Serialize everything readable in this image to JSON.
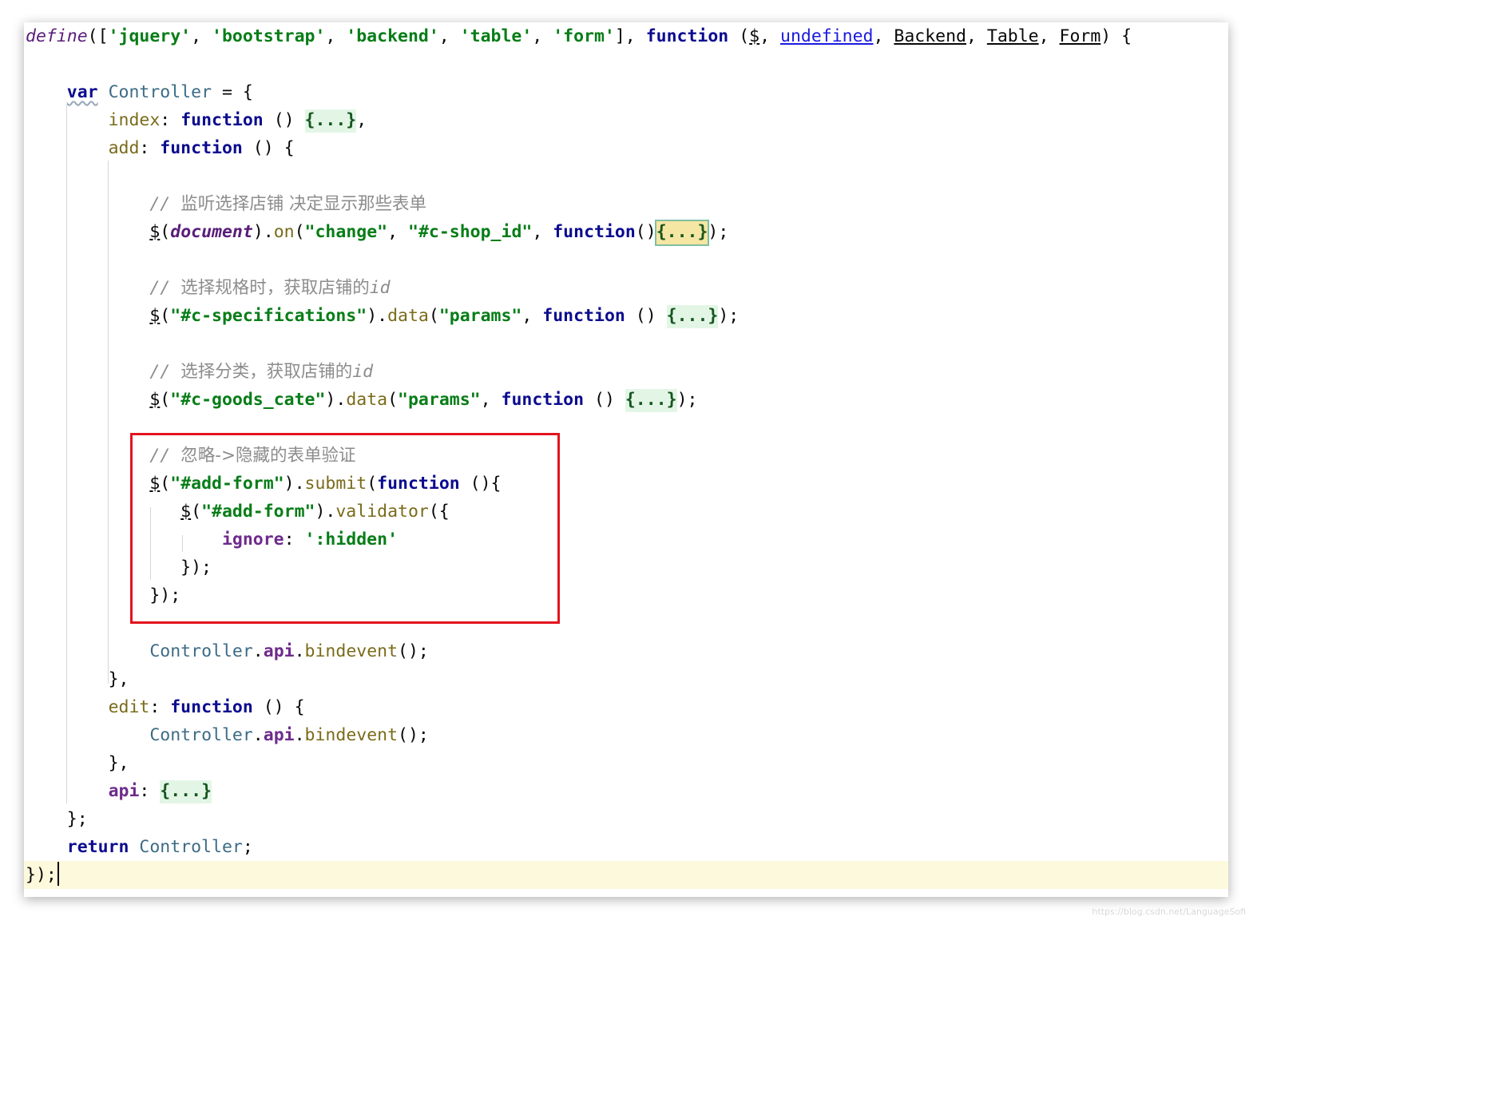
{
  "editor": {
    "lines": [
      [
        {
          "t": "define",
          "c": "define"
        },
        {
          "t": "(["
        },
        {
          "t": "'jquery'",
          "c": "str"
        },
        {
          "t": ", "
        },
        {
          "t": "'bootstrap'",
          "c": "str"
        },
        {
          "t": ", "
        },
        {
          "t": "'backend'",
          "c": "str"
        },
        {
          "t": ", "
        },
        {
          "t": "'table'",
          "c": "str"
        },
        {
          "t": ", "
        },
        {
          "t": "'form'",
          "c": "str"
        },
        {
          "t": "], "
        },
        {
          "t": "function",
          "c": "kw"
        },
        {
          "t": " ("
        },
        {
          "t": "$",
          "c": "ul"
        },
        {
          "t": ", "
        },
        {
          "t": "undefined",
          "c": "link"
        },
        {
          "t": ", "
        },
        {
          "t": "Backend",
          "c": "ul"
        },
        {
          "t": ", "
        },
        {
          "t": "Table",
          "c": "ul"
        },
        {
          "t": ", "
        },
        {
          "t": "Form",
          "c": "ul"
        },
        {
          "t": ") {"
        }
      ],
      [],
      [
        {
          "t": "    "
        },
        {
          "t": "var",
          "c": "kw wavy"
        },
        {
          "t": " "
        },
        {
          "t": "Controller",
          "c": "name"
        },
        {
          "t": " = {"
        }
      ],
      [
        {
          "t": "        "
        },
        {
          "t": "index",
          "c": "meth"
        },
        {
          "t": ": "
        },
        {
          "t": "function",
          "c": "kw"
        },
        {
          "t": " () "
        },
        {
          "t": "{...}",
          "c": "fold"
        },
        {
          "t": ","
        }
      ],
      [
        {
          "t": "        "
        },
        {
          "t": "add",
          "c": "meth"
        },
        {
          "t": ": "
        },
        {
          "t": "function",
          "c": "kw"
        },
        {
          "t": " () {"
        }
      ],
      [],
      [
        {
          "t": "            "
        },
        {
          "t": "// ",
          "c": "cmt"
        },
        {
          "t": "监听选择店铺 决定显示那些表单",
          "c": "cmtcjk"
        }
      ],
      [
        {
          "t": "            "
        },
        {
          "t": "$",
          "c": "ul"
        },
        {
          "t": "("
        },
        {
          "t": "document",
          "c": "glob"
        },
        {
          "t": ")."
        },
        {
          "t": "on",
          "c": "meth"
        },
        {
          "t": "("
        },
        {
          "t": "\"change\"",
          "c": "str"
        },
        {
          "t": ", "
        },
        {
          "t": "\"#c-shop_id\"",
          "c": "str"
        },
        {
          "t": ", "
        },
        {
          "t": "function",
          "c": "kw"
        },
        {
          "t": "()"
        },
        {
          "t": "{...}",
          "c": "fold sel"
        },
        {
          "t": ");"
        }
      ],
      [],
      [
        {
          "t": "            "
        },
        {
          "t": "// ",
          "c": "cmt"
        },
        {
          "t": "选择规格时，获取店铺的",
          "c": "cmtcjk"
        },
        {
          "t": "id",
          "c": "cmt"
        }
      ],
      [
        {
          "t": "            "
        },
        {
          "t": "$",
          "c": "ul"
        },
        {
          "t": "("
        },
        {
          "t": "\"#c-specifications\"",
          "c": "str"
        },
        {
          "t": ")."
        },
        {
          "t": "data",
          "c": "meth"
        },
        {
          "t": "("
        },
        {
          "t": "\"params\"",
          "c": "str"
        },
        {
          "t": ", "
        },
        {
          "t": "function",
          "c": "kw"
        },
        {
          "t": " () "
        },
        {
          "t": "{...}",
          "c": "fold"
        },
        {
          "t": ");"
        }
      ],
      [],
      [
        {
          "t": "            "
        },
        {
          "t": "// ",
          "c": "cmt"
        },
        {
          "t": "选择分类，获取店铺的",
          "c": "cmtcjk"
        },
        {
          "t": "id",
          "c": "cmt"
        }
      ],
      [
        {
          "t": "            "
        },
        {
          "t": "$",
          "c": "ul"
        },
        {
          "t": "("
        },
        {
          "t": "\"#c-goods_cate\"",
          "c": "str"
        },
        {
          "t": ")."
        },
        {
          "t": "data",
          "c": "meth"
        },
        {
          "t": "("
        },
        {
          "t": "\"params\"",
          "c": "str"
        },
        {
          "t": ", "
        },
        {
          "t": "function",
          "c": "kw"
        },
        {
          "t": " () "
        },
        {
          "t": "{...}",
          "c": "fold"
        },
        {
          "t": ");"
        }
      ],
      [],
      [
        {
          "t": "            "
        },
        {
          "t": "// ",
          "c": "cmt"
        },
        {
          "t": "忽略->隐藏的表单验证",
          "c": "cmtcjk"
        }
      ],
      [
        {
          "t": "            "
        },
        {
          "t": "$",
          "c": "ul"
        },
        {
          "t": "("
        },
        {
          "t": "\"#add-form\"",
          "c": "str"
        },
        {
          "t": ")."
        },
        {
          "t": "submit",
          "c": "meth"
        },
        {
          "t": "("
        },
        {
          "t": "function",
          "c": "kw"
        },
        {
          "t": " (){"
        }
      ],
      [
        {
          "t": "               "
        },
        {
          "t": "$",
          "c": "ul"
        },
        {
          "t": "("
        },
        {
          "t": "\"#add-form\"",
          "c": "str"
        },
        {
          "t": ")."
        },
        {
          "t": "validator",
          "c": "meth"
        },
        {
          "t": "({"
        }
      ],
      [
        {
          "t": "                   "
        },
        {
          "t": "ignore",
          "c": "prop"
        },
        {
          "t": ": "
        },
        {
          "t": "':hidden'",
          "c": "str"
        }
      ],
      [
        {
          "t": "               "
        },
        {
          "t": "});"
        }
      ],
      [
        {
          "t": "            "
        },
        {
          "t": "});"
        }
      ],
      [],
      [
        {
          "t": "            "
        },
        {
          "t": "Controller",
          "c": "name"
        },
        {
          "t": "."
        },
        {
          "t": "api",
          "c": "prop"
        },
        {
          "t": "."
        },
        {
          "t": "bindevent",
          "c": "meth"
        },
        {
          "t": "();"
        }
      ],
      [
        {
          "t": "        "
        },
        {
          "t": "},"
        }
      ],
      [
        {
          "t": "        "
        },
        {
          "t": "edit",
          "c": "meth"
        },
        {
          "t": ": "
        },
        {
          "t": "function",
          "c": "kw"
        },
        {
          "t": " () {"
        }
      ],
      [
        {
          "t": "            "
        },
        {
          "t": "Controller",
          "c": "name"
        },
        {
          "t": "."
        },
        {
          "t": "api",
          "c": "prop"
        },
        {
          "t": "."
        },
        {
          "t": "bindevent",
          "c": "meth"
        },
        {
          "t": "();"
        }
      ],
      [
        {
          "t": "        "
        },
        {
          "t": "},"
        }
      ],
      [
        {
          "t": "        "
        },
        {
          "t": "api",
          "c": "prop"
        },
        {
          "t": ": "
        },
        {
          "t": "{...}",
          "c": "fold"
        }
      ],
      [
        {
          "t": "    "
        },
        {
          "t": "};"
        }
      ],
      [
        {
          "t": "    "
        },
        {
          "t": "return",
          "c": "kw"
        },
        {
          "t": " "
        },
        {
          "t": "Controller",
          "c": "name"
        },
        {
          "t": ";"
        }
      ],
      [
        {
          "t": "});"
        }
      ]
    ]
  },
  "watermark": "https://blog.csdn.net/LanguageSofi"
}
